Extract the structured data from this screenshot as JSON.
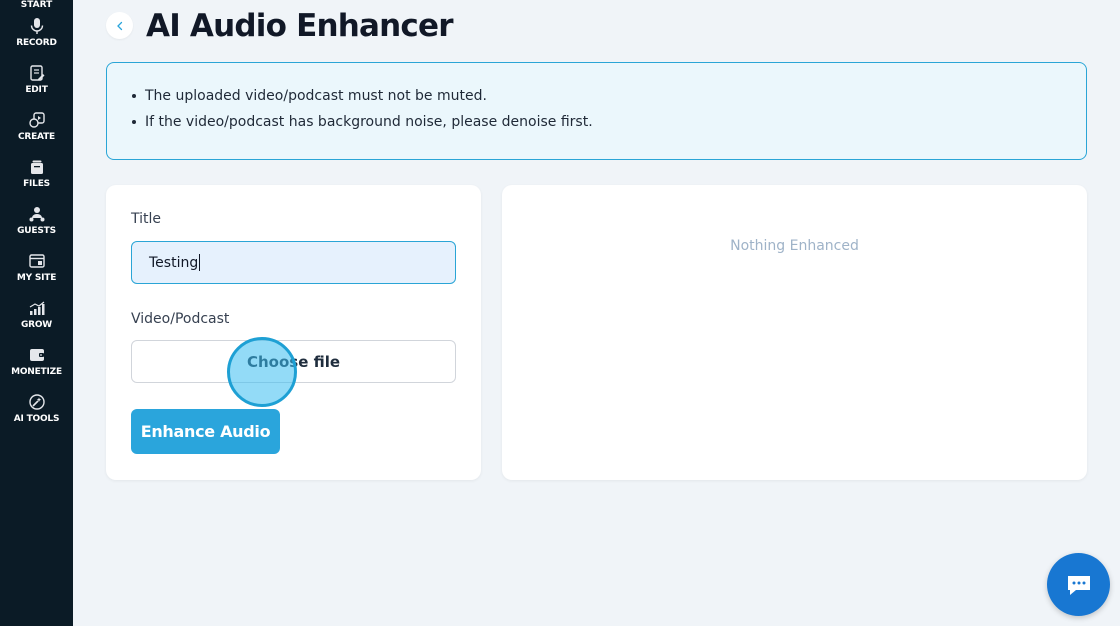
{
  "sidebar": {
    "start_label": "START",
    "items": [
      {
        "label": "RECORD",
        "icon": "microphone-icon"
      },
      {
        "label": "EDIT",
        "icon": "edit-document-icon"
      },
      {
        "label": "CREATE",
        "icon": "create-media-icon"
      },
      {
        "label": "FILES",
        "icon": "files-icon"
      },
      {
        "label": "GUESTS",
        "icon": "guests-icon"
      },
      {
        "label": "MY SITE",
        "icon": "website-icon"
      },
      {
        "label": "GROW",
        "icon": "growth-chart-icon"
      },
      {
        "label": "MONETIZE",
        "icon": "monetize-icon"
      },
      {
        "label": "AI TOOLS",
        "icon": "ai-tools-icon"
      }
    ]
  },
  "header": {
    "title": "AI Audio Enhancer"
  },
  "info": {
    "items": [
      "The uploaded video/podcast must not be muted.",
      "If the video/podcast has background noise, please denoise first."
    ]
  },
  "form": {
    "title_label": "Title",
    "title_value": "Testing",
    "file_label": "Video/Podcast",
    "file_button_label": "Choose file",
    "submit_label": "Enhance Audio"
  },
  "result": {
    "empty_text": "Nothing Enhanced"
  },
  "colors": {
    "sidebar_bg": "#0b1b26",
    "accent": "#2aa5dc",
    "chat_button": "#1877d2",
    "page_bg": "#f0f4f8"
  }
}
